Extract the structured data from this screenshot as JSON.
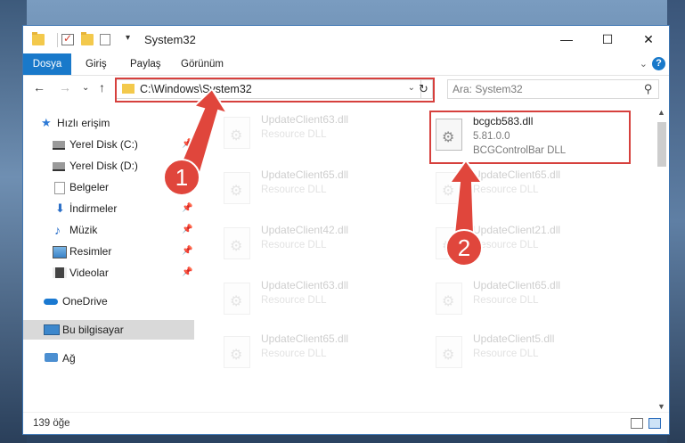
{
  "window": {
    "title": "System32",
    "controls": {
      "minimize": "—",
      "maximize": "☐",
      "close": "✕"
    }
  },
  "ribbon": {
    "tabs": [
      {
        "label": "Dosya",
        "active": true
      },
      {
        "label": "Giriş"
      },
      {
        "label": "Paylaş"
      },
      {
        "label": "Görünüm"
      }
    ],
    "help": "?"
  },
  "navigation": {
    "address": "C:\\Windows\\System32",
    "search_placeholder": "Ara: System32"
  },
  "sidebar": {
    "quick_access": "Hızlı erişim",
    "items": [
      {
        "label": "Yerel Disk (C:)",
        "icon": "drive-icon",
        "pinned": true
      },
      {
        "label": "Yerel Disk (D:)",
        "icon": "drive-icon",
        "pinned": true
      },
      {
        "label": "Belgeler",
        "icon": "documents-icon",
        "pinned": true
      },
      {
        "label": "İndirmeler",
        "icon": "downloads-icon",
        "pinned": true
      },
      {
        "label": "Müzik",
        "icon": "music-icon",
        "pinned": true
      },
      {
        "label": "Resimler",
        "icon": "pictures-icon",
        "pinned": true
      },
      {
        "label": "Videolar",
        "icon": "videos-icon",
        "pinned": true
      }
    ],
    "onedrive": "OneDrive",
    "this_pc": "Bu bilgisayar",
    "network": "Ağ"
  },
  "files": {
    "highlighted": {
      "name": "bcgcb583.dll",
      "version": "5.81.0.0",
      "description": "BCGControlBar DLL"
    },
    "ghost_left": [
      {
        "name": "UpdateClient63.dll",
        "type": "Resource DLL"
      },
      {
        "name": "UpdateClient65.dll",
        "type": "Resource DLL"
      },
      {
        "name": "UpdateClient42.dll",
        "type": "Resource DLL"
      },
      {
        "name": "UpdateClient63.dll",
        "type": "Resource DLL"
      },
      {
        "name": "UpdateClient65.dll",
        "type": "Resource DLL"
      }
    ],
    "ghost_right": [
      {
        "name": "UpdateClient65.dll",
        "type": "Resource DLL"
      },
      {
        "name": "UpdateClient21.dll",
        "type": "Resource DLL"
      },
      {
        "name": "UpdateClient65.dll",
        "type": "Resource DLL"
      },
      {
        "name": "UpdateClient5.dll",
        "type": "Resource DLL"
      }
    ]
  },
  "status": {
    "item_count": "139 öğe"
  },
  "annotations": {
    "marker1": "1",
    "marker2": "2",
    "color": "#e0463c"
  }
}
